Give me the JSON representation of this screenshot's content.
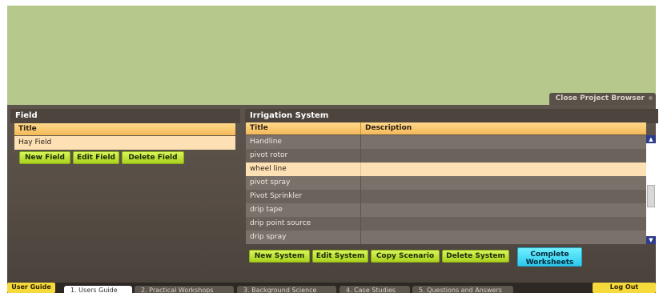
{
  "map": {
    "close_label": "Close Project Browser"
  },
  "field_panel": {
    "title": "Field",
    "column_title": "Title",
    "rows": [
      "Hay Field"
    ],
    "buttons": {
      "new": "New Field",
      "edit": "Edit Field",
      "delete": "Delete Field"
    }
  },
  "irrigation_panel": {
    "title": "Irrigation System",
    "columns": {
      "title": "Title",
      "description": "Description"
    },
    "rows": [
      {
        "title": "Handline",
        "description": ""
      },
      {
        "title": "pivot rotor",
        "description": ""
      },
      {
        "title": "wheel line",
        "description": "",
        "selected": true
      },
      {
        "title": "pivot spray",
        "description": ""
      },
      {
        "title": "Pivot Sprinkler",
        "description": ""
      },
      {
        "title": "drip tape",
        "description": ""
      },
      {
        "title": "drip point source",
        "description": ""
      },
      {
        "title": "drip spray",
        "description": ""
      }
    ],
    "buttons": {
      "new": "New System",
      "edit": "Edit System",
      "copy": "Copy Scenario",
      "delete": "Delete System",
      "complete_line1": "Complete",
      "complete_line2": "Worksheets"
    }
  },
  "bottom_bar": {
    "user_guide": "User Guide",
    "tabs": [
      "1. Users Guide",
      "2. Practical Workshops",
      "3. Background Science",
      "4. Case Studies",
      "5. Questions and Answers"
    ],
    "active_tab_index": 0,
    "logout": "Log Out"
  },
  "colors": {
    "map_background": "#b6c88c",
    "header_orange": "#f4b95a",
    "selected_row": "#fde0b4",
    "button_green": "#c3e63a",
    "button_cyan": "#3fd8f5",
    "button_yellow": "#f6d93a"
  },
  "icons": [
    "pin-icon",
    "scroll-up-arrow-icon",
    "scroll-down-arrow-icon"
  ]
}
